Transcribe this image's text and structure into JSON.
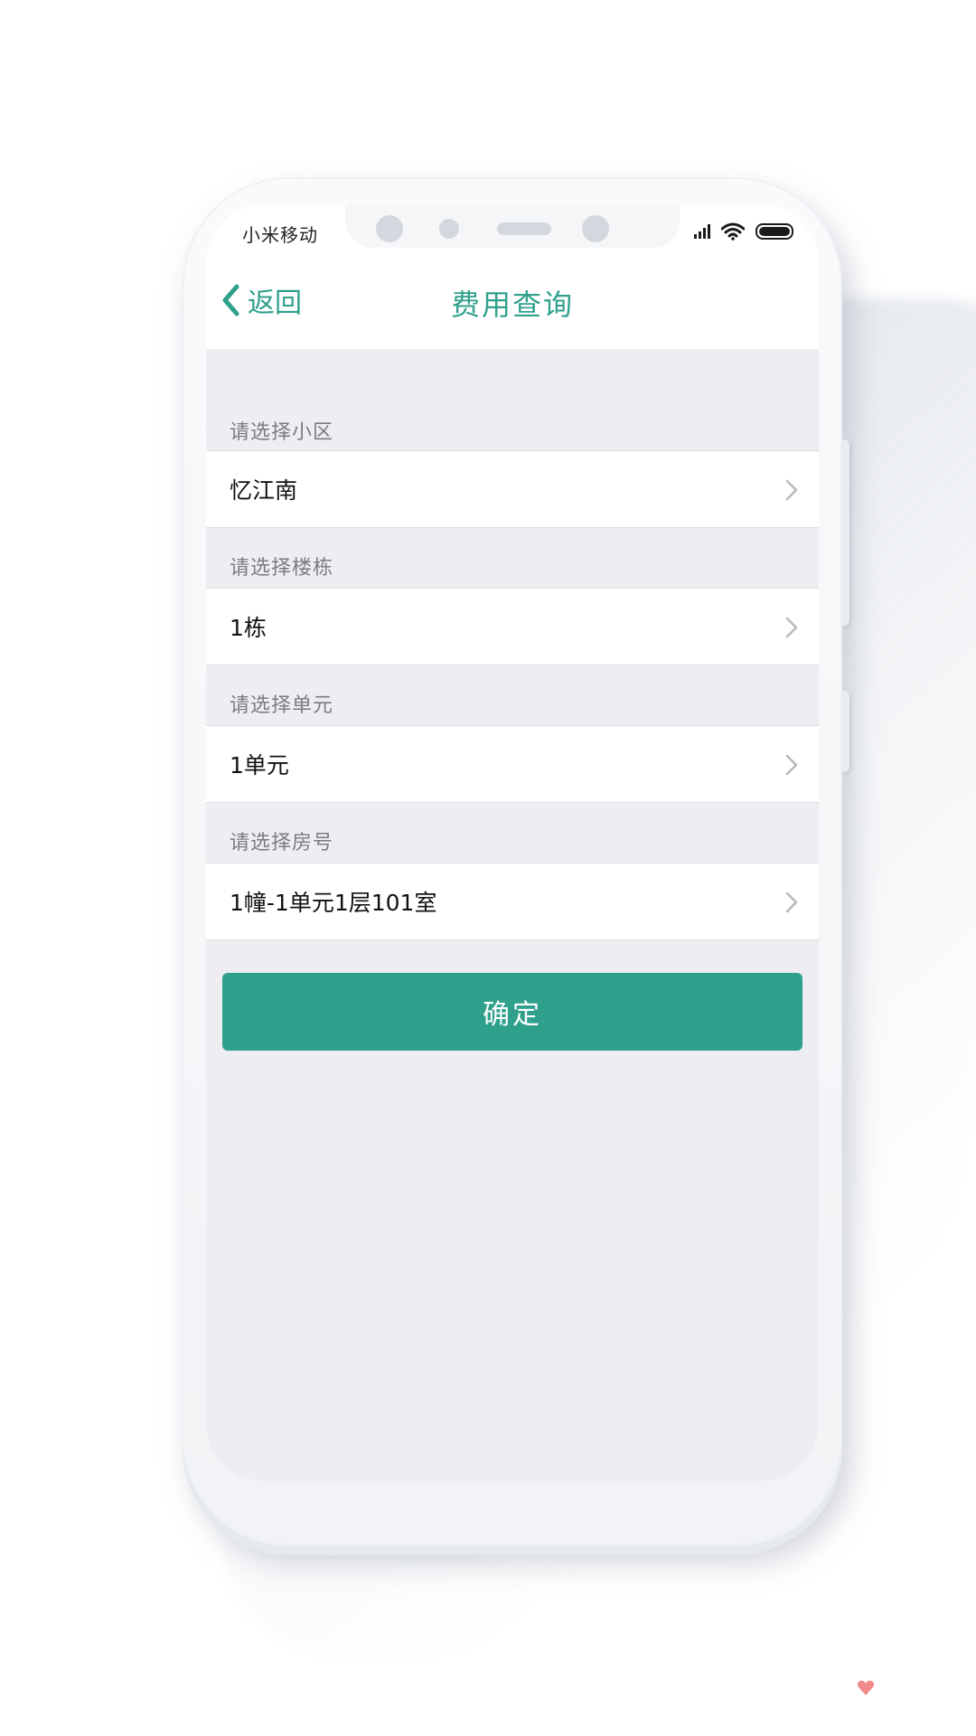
{
  "status_bar": {
    "carrier": "小米移动",
    "icons": [
      "signal-icon",
      "wifi-icon",
      "battery-icon"
    ]
  },
  "nav": {
    "back_label": "返回",
    "title": "费用查询"
  },
  "form": {
    "sections": [
      {
        "label": "请选择小区",
        "value": "忆江南"
      },
      {
        "label": "请选择楼栋",
        "value": "1栋"
      },
      {
        "label": "请选择单元",
        "value": "1单元"
      },
      {
        "label": "请选择房号",
        "value": "1幢-1单元1层101室"
      }
    ],
    "confirm_label": "确定"
  },
  "colors": {
    "accent": "#2fa08c",
    "background": "#ededf2"
  }
}
